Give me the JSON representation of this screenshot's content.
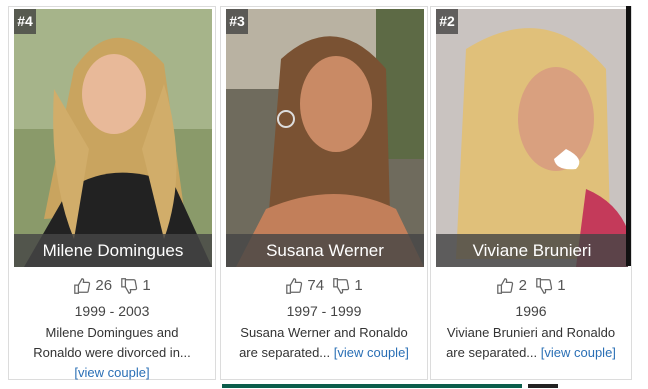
{
  "cards": [
    {
      "rank": "#4",
      "name": "Milene Domingues",
      "likes": "26",
      "dislikes": "1",
      "years": "1999 - 2003",
      "desc_line1": "Milene Domingues and",
      "desc_line2": "Ronaldo were divorced in...",
      "link": "[view couple]"
    },
    {
      "rank": "#3",
      "name": "Susana Werner",
      "likes": "74",
      "dislikes": "1",
      "years": "1997 - 1999",
      "desc_line1": "Susana Werner and Ronaldo",
      "desc_line2": "are separated...",
      "link": "[view couple]"
    },
    {
      "rank": "#2",
      "name": "Viviane Brunieri",
      "likes": "2",
      "dislikes": "1",
      "years": "1996",
      "desc_line1": "Viviane Brunieri and Ronaldo",
      "desc_line2": "are separated...",
      "link": "[view couple]"
    }
  ],
  "icons": {
    "like": "thumbs-up-icon",
    "dislike": "thumbs-down-icon"
  }
}
